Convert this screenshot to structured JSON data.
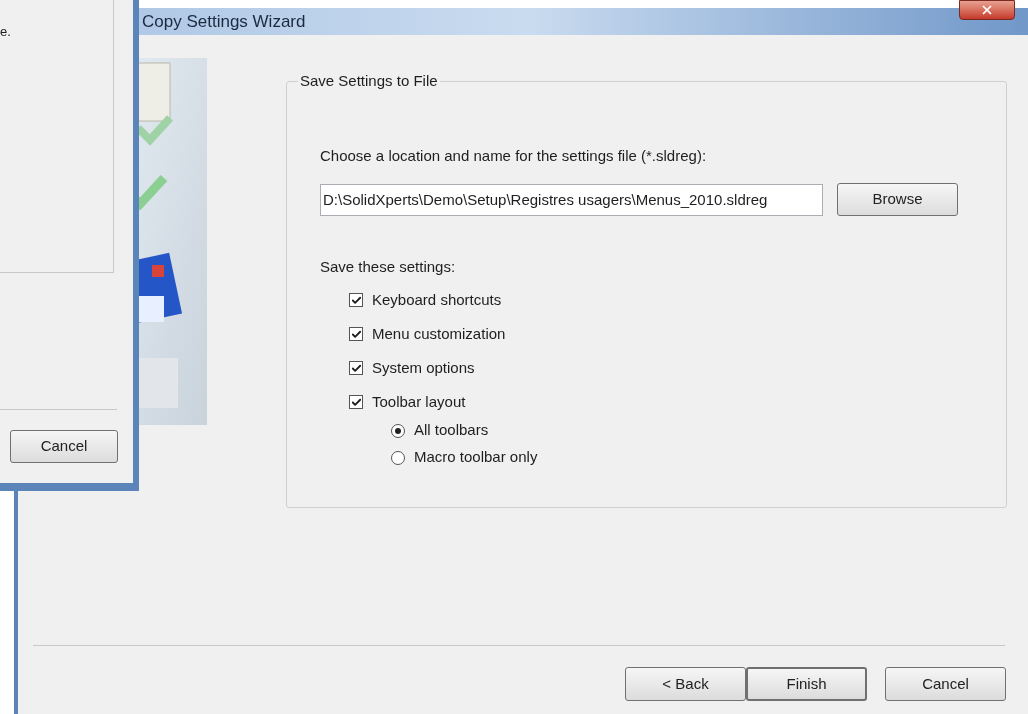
{
  "back_window": {
    "text": "e.",
    "buttons": [
      "Cancel"
    ]
  },
  "window": {
    "title": "Copy Settings Wizard"
  },
  "group": {
    "title": "Save Settings to File",
    "prompt": "Choose a location and name for the settings file (*.sldreg):",
    "file_path": "D:\\SolidXperts\\Demo\\Setup\\Registres usagers\\Menus_2010.sldreg",
    "browse": "Browse",
    "settings_label": "Save these settings:",
    "settings": [
      {
        "label": "Keyboard shortcuts",
        "checked": true
      },
      {
        "label": "Menu customization",
        "checked": true
      },
      {
        "label": "System options",
        "checked": true
      },
      {
        "label": "Toolbar layout",
        "checked": true
      }
    ],
    "toolbar_options": [
      {
        "label": "All toolbars",
        "selected": true
      },
      {
        "label": "Macro toolbar only",
        "selected": false
      }
    ]
  },
  "buttons": [
    {
      "label": "< Back",
      "default": false
    },
    {
      "label": "Finish",
      "default": true
    },
    {
      "label": "Cancel",
      "default": false
    }
  ]
}
